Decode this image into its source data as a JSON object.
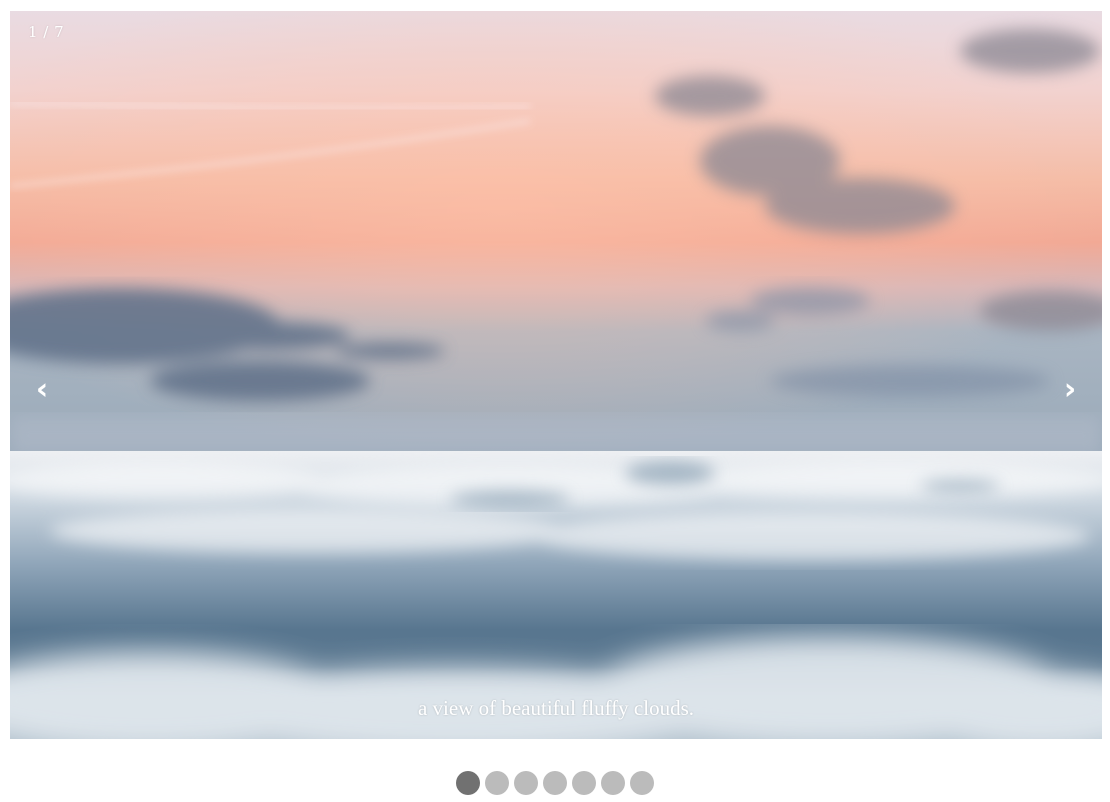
{
  "slideshow": {
    "counter": "1 / 7",
    "caption": "a view of beautiful fluffy clouds.",
    "prev_icon": "‹",
    "next_icon": "›",
    "image_subject": "sunset sky above a sea of clouds",
    "total_slides": 7,
    "active_slide": 1
  },
  "colors": {
    "dot_active": "#717171",
    "dot_inactive": "#bbbbbb",
    "text": "#ffffff"
  },
  "icons": {
    "prev": "chevron-left-icon",
    "next": "chevron-right-icon"
  }
}
